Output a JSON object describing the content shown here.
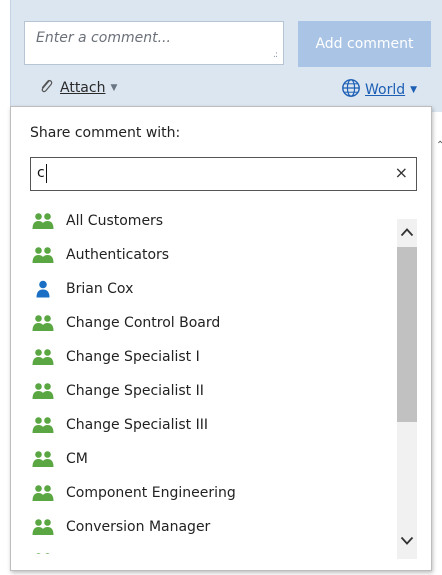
{
  "comment": {
    "placeholder": "Enter a comment...",
    "add_button": "Add comment",
    "attach_label": "Attach",
    "visibility_label": "World"
  },
  "share_popup": {
    "title": "Share comment with:",
    "filter_value": "c",
    "clear_symbol": "×",
    "items": [
      {
        "label": "All Customers",
        "type": "group"
      },
      {
        "label": "Authenticators",
        "type": "group"
      },
      {
        "label": "Brian Cox",
        "type": "user"
      },
      {
        "label": "Change Control Board",
        "type": "group"
      },
      {
        "label": "Change Specialist I",
        "type": "group"
      },
      {
        "label": "Change Specialist II",
        "type": "group"
      },
      {
        "label": "Change Specialist III",
        "type": "group"
      },
      {
        "label": "CM",
        "type": "group"
      },
      {
        "label": "Component Engineering",
        "type": "group"
      },
      {
        "label": "Conversion Manager",
        "type": "group"
      }
    ]
  },
  "colors": {
    "group_icon": "#5aa642",
    "user_icon": "#1a6fc4",
    "comment_bar_bg": "#dce6f1",
    "add_button_bg": "#a9c4e4",
    "link_blue": "#1d5fb4"
  }
}
